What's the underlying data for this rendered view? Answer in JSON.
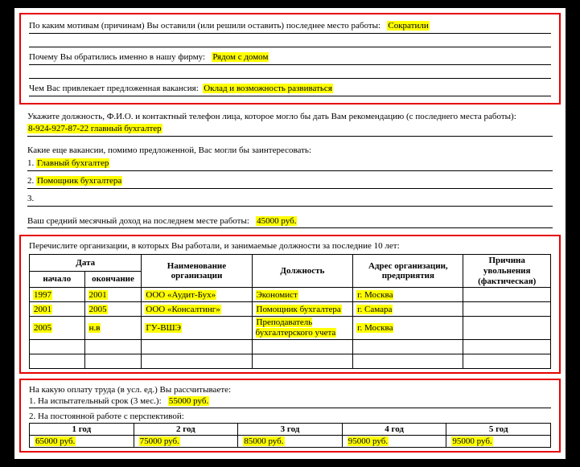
{
  "box1": {
    "q1_label": "По каким мотивам (причинам) Вы оставили (или решили оставить) последнее место работы:",
    "q1_answer": "Сократили",
    "q2_label": "Почему Вы обратились именно в нашу фирму:",
    "q2_answer": "Рядом с домом",
    "q3_label": "Чем Вас привлекает предложенная вакансия:",
    "q3_answer": "Оклад и возможность развиваться"
  },
  "recommend": {
    "label": "Укажите должность, Ф.И.О. и контактный телефон лица, которое могло бы дать Вам рекомендацию (с последнего места работы):",
    "answer": "8-924-927-87-22 главный бухгалтер"
  },
  "vacancies": {
    "label": "Какие еще вакансии, помимо предложенной, Вас могли бы заинтересовать:",
    "v1": "Главный бухгалтер",
    "v2": "Помощник бухгалтера",
    "v3": ""
  },
  "income": {
    "label": "Ваш средний месячный доход на последнем месте работы:",
    "answer": "45000 руб."
  },
  "work": {
    "title": "Перечислите организации, в которых Вы работали, и занимаемые должности за последние 10 лет:",
    "headers": {
      "date": "Дата",
      "start": "начало",
      "end": "окончание",
      "org": "Наименование организации",
      "position": "Должность",
      "address": "Адрес организации, предприятия",
      "reason": "Причина увольнения (фактическая)"
    },
    "rows": [
      {
        "start": "1997",
        "end": "2001",
        "org": "ООО «Аудит-Бух»",
        "position": "Экономист",
        "address": "г. Москва",
        "reason": ""
      },
      {
        "start": "2001",
        "end": "2005",
        "org": "ООО «Консалтинг»",
        "position": "Помощник бухгалтера",
        "address": "г. Самара",
        "reason": ""
      },
      {
        "start": "2005",
        "end": "н.в",
        "org": "ГУ-ВШЭ",
        "position": "Преподаватель бухгалтерского учета",
        "address": "г. Москва",
        "reason": ""
      }
    ]
  },
  "salary": {
    "title": "На какую оплату труда (в усл. ед.) Вы рассчитываете:",
    "probation_label": "1. На испытательный срок (3 мес.):",
    "probation_answer": "55000 руб.",
    "perm_label": "2. На постоянной работе с перспективой:",
    "cols": {
      "y1": "1 год",
      "y2": "2 год",
      "y3": "3 год",
      "y4": "4 год",
      "y5": "5 год"
    },
    "vals": {
      "y1": "65000 руб.",
      "y2": "75000 руб.",
      "y3": "85000 руб.",
      "y4": "95000 руб.",
      "y5": "95000 руб."
    }
  }
}
